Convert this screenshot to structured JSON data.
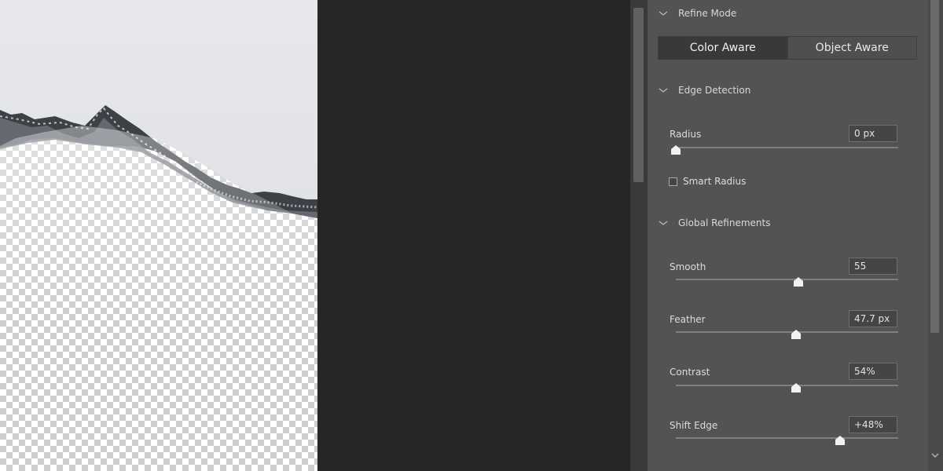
{
  "preview": {
    "description_icon": "mountain-photo-layer",
    "transparency": "checkerboard"
  },
  "panel": {
    "refine_mode": {
      "title": "Refine Mode",
      "options": [
        "Color Aware",
        "Object Aware"
      ],
      "selected": "Color Aware"
    },
    "edge_detection": {
      "title": "Edge Detection",
      "radius": {
        "label": "Radius",
        "value": "0 px",
        "level": 0.0
      },
      "smart_radius": {
        "label": "Smart Radius",
        "checked": false
      }
    },
    "global_refinements": {
      "title": "Global Refinements",
      "sliders": [
        {
          "label": "Smooth",
          "value": "55",
          "level": 0.55
        },
        {
          "label": "Feather",
          "value": "47.7 px",
          "level": 0.54
        },
        {
          "label": "Contrast",
          "value": "54%",
          "level": 0.54
        },
        {
          "label": "Shift Edge",
          "value": "+48%",
          "level": 0.74
        }
      ]
    }
  },
  "colors": {
    "panel_bg": "#535353",
    "workspace_bg": "#262626",
    "active_segment": "#393939"
  }
}
